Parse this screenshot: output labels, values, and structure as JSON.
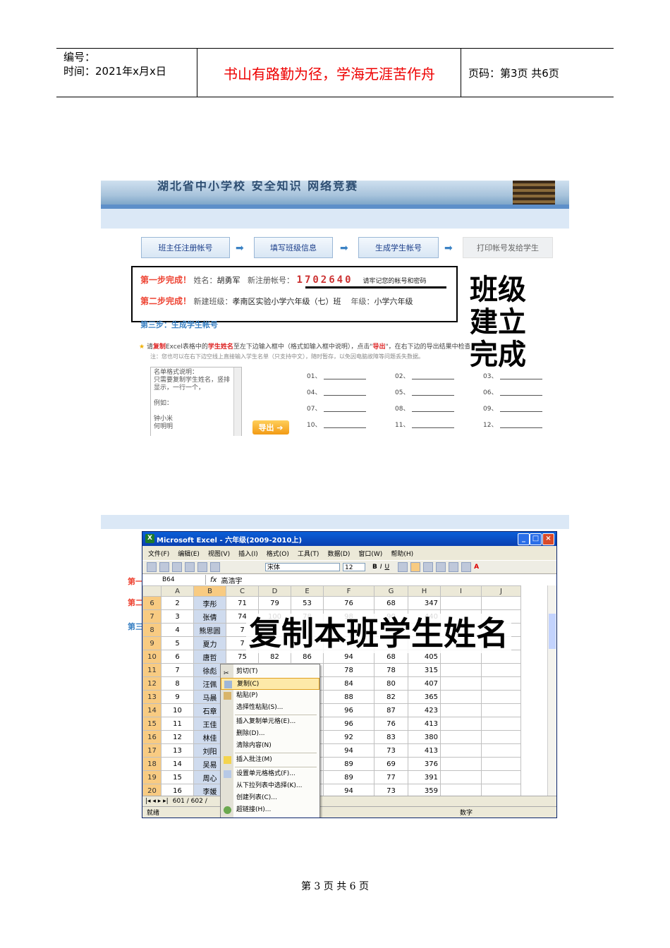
{
  "header": {
    "code_label": "编号：",
    "date_label": "时间：2021年x月x日",
    "motto": "书山有路勤为径，学海无涯苦作舟",
    "page_info": "页码：第3页  共6页"
  },
  "shot1": {
    "banner_text": "湖北省中小学校  安全知识  网络竞赛",
    "steps": [
      "班主任注册帐号",
      "填写班级信息",
      "生成学生帐号",
      "打印帐号发给学生"
    ],
    "row1": {
      "done": "第一步完成！",
      "name_label": "姓名：",
      "name": "胡勇军",
      "acct_label": "新注册帐号：",
      "acct": "1702640",
      "remind": "请牢记您的帐号和密码"
    },
    "row2": {
      "done": "第二步完成！",
      "class_label": "新建班级：",
      "class": "孝南区实验小学六年级（七）班",
      "grade_label": "年级：",
      "grade": "小学六年级"
    },
    "overlay": [
      "班级",
      "建立",
      "完成"
    ],
    "step3": "第三步：生成学生帐号",
    "instr_pre": "请",
    "instr_copy": "复制",
    "instr_mid": "Excel表格中的",
    "instr_names": "学生姓名",
    "instr_rest": "至左下边输入框中（格式如输入框中说明），点击\"",
    "instr_export": "导出",
    "instr_tail": "\"，在右下边的导出结果中检查无误后点击下一步!",
    "note": "注：您也可以在右下边空线上直接输入学生名单（只支持中文），随时暂存，以免因电脑故障等问题丢失数据。",
    "namebox_lines": [
      "名单格式说明：",
      "只需要复制学生姓名，竖排",
      "显示，一行一个，",
      "",
      "例如：",
      "",
      "钟小米",
      "何明明"
    ],
    "export_btn": "导出",
    "fields": [
      "01、",
      "02、",
      "03、",
      "04、",
      "05、",
      "06、",
      "07、",
      "08、",
      "09、",
      "10、",
      "11、",
      "12、"
    ]
  },
  "shot2": {
    "side_labels": [
      "第一",
      "第二",
      "第三"
    ],
    "title": "Microsoft Excel - 六年级(2009-2010上)",
    "menus": [
      "文件(F)",
      "编辑(E)",
      "视图(V)",
      "插入(I)",
      "格式(O)",
      "工具(T)",
      "数据(D)",
      "窗口(W)",
      "帮助(H)"
    ],
    "font_name": "宋体",
    "font_size": "12",
    "cell_ref": "B64",
    "formula": "高浩宇",
    "columns": [
      "A",
      "B",
      "C",
      "D",
      "E",
      "F",
      "G",
      "H",
      "I",
      "J"
    ],
    "rows": [
      {
        "r": "6",
        "a": "2",
        "b": "李彤",
        "c": "71",
        "d": "79",
        "e": "53",
        "f": "76",
        "g": "68",
        "h": "347"
      },
      {
        "r": "7",
        "a": "3",
        "b": "张倩",
        "c": "74",
        "d": "100",
        "e": "78",
        "f": "98",
        "g": "90",
        "h": "440"
      },
      {
        "r": "8",
        "a": "4",
        "b": "熊思圆",
        "c": "7",
        "d": "",
        "e": "",
        "f": "",
        "g": "",
        "h": ""
      },
      {
        "r": "9",
        "a": "5",
        "b": "夏力",
        "c": "7",
        "d": "",
        "e": "",
        "f": "",
        "g": "",
        "h": ""
      },
      {
        "r": "10",
        "a": "6",
        "b": "唐哲",
        "c": "75",
        "d": "82",
        "e": "86",
        "f": "94",
        "g": "68",
        "h": "405"
      },
      {
        "r": "11",
        "a": "7",
        "b": "徐彪",
        "c": "",
        "d": "",
        "e": "",
        "f": "78",
        "g": "78",
        "h": "315"
      },
      {
        "r": "12",
        "a": "8",
        "b": "汪佩",
        "c": "",
        "d": "",
        "e": "",
        "f": "84",
        "g": "80",
        "h": "407"
      },
      {
        "r": "13",
        "a": "9",
        "b": "马晨",
        "c": "",
        "d": "",
        "e": "",
        "f": "88",
        "g": "82",
        "h": "365"
      },
      {
        "r": "14",
        "a": "10",
        "b": "石章",
        "c": "",
        "d": "",
        "e": "",
        "f": "96",
        "g": "87",
        "h": "423"
      },
      {
        "r": "15",
        "a": "11",
        "b": "王佳",
        "c": "",
        "d": "",
        "e": "",
        "f": "96",
        "g": "76",
        "h": "413"
      },
      {
        "r": "16",
        "a": "12",
        "b": "林佳",
        "c": "",
        "d": "",
        "e": "",
        "f": "92",
        "g": "83",
        "h": "380"
      },
      {
        "r": "17",
        "a": "13",
        "b": "刘阳",
        "c": "",
        "d": "",
        "e": "",
        "f": "94",
        "g": "73",
        "h": "413"
      },
      {
        "r": "18",
        "a": "14",
        "b": "吴易",
        "c": "",
        "d": "",
        "e": "",
        "f": "89",
        "g": "69",
        "h": "376"
      },
      {
        "r": "19",
        "a": "15",
        "b": "周心",
        "c": "",
        "d": "",
        "e": "",
        "f": "89",
        "g": "77",
        "h": "391"
      },
      {
        "r": "20",
        "a": "16",
        "b": "李媛",
        "c": "",
        "d": "",
        "e": "",
        "f": "94",
        "g": "73",
        "h": "359"
      }
    ],
    "context_menu": [
      "剪切(T)",
      "复制(C)",
      "粘贴(P)",
      "选择性粘贴(S)...",
      "插入复制单元格(E)...",
      "删除(D)...",
      "清除内容(N)",
      "插入批注(M)",
      "设置单元格格式(F)...",
      "从下拉列表中选择(K)...",
      "创建列表(C)...",
      "超链接(H)..."
    ],
    "sheet_tabs": "601 / 602 /",
    "status_ready": "就绪",
    "status_mode": "数字",
    "overlay": "复制本班学生姓名"
  },
  "footer": {
    "page": "第 3 页 共 6 页"
  }
}
